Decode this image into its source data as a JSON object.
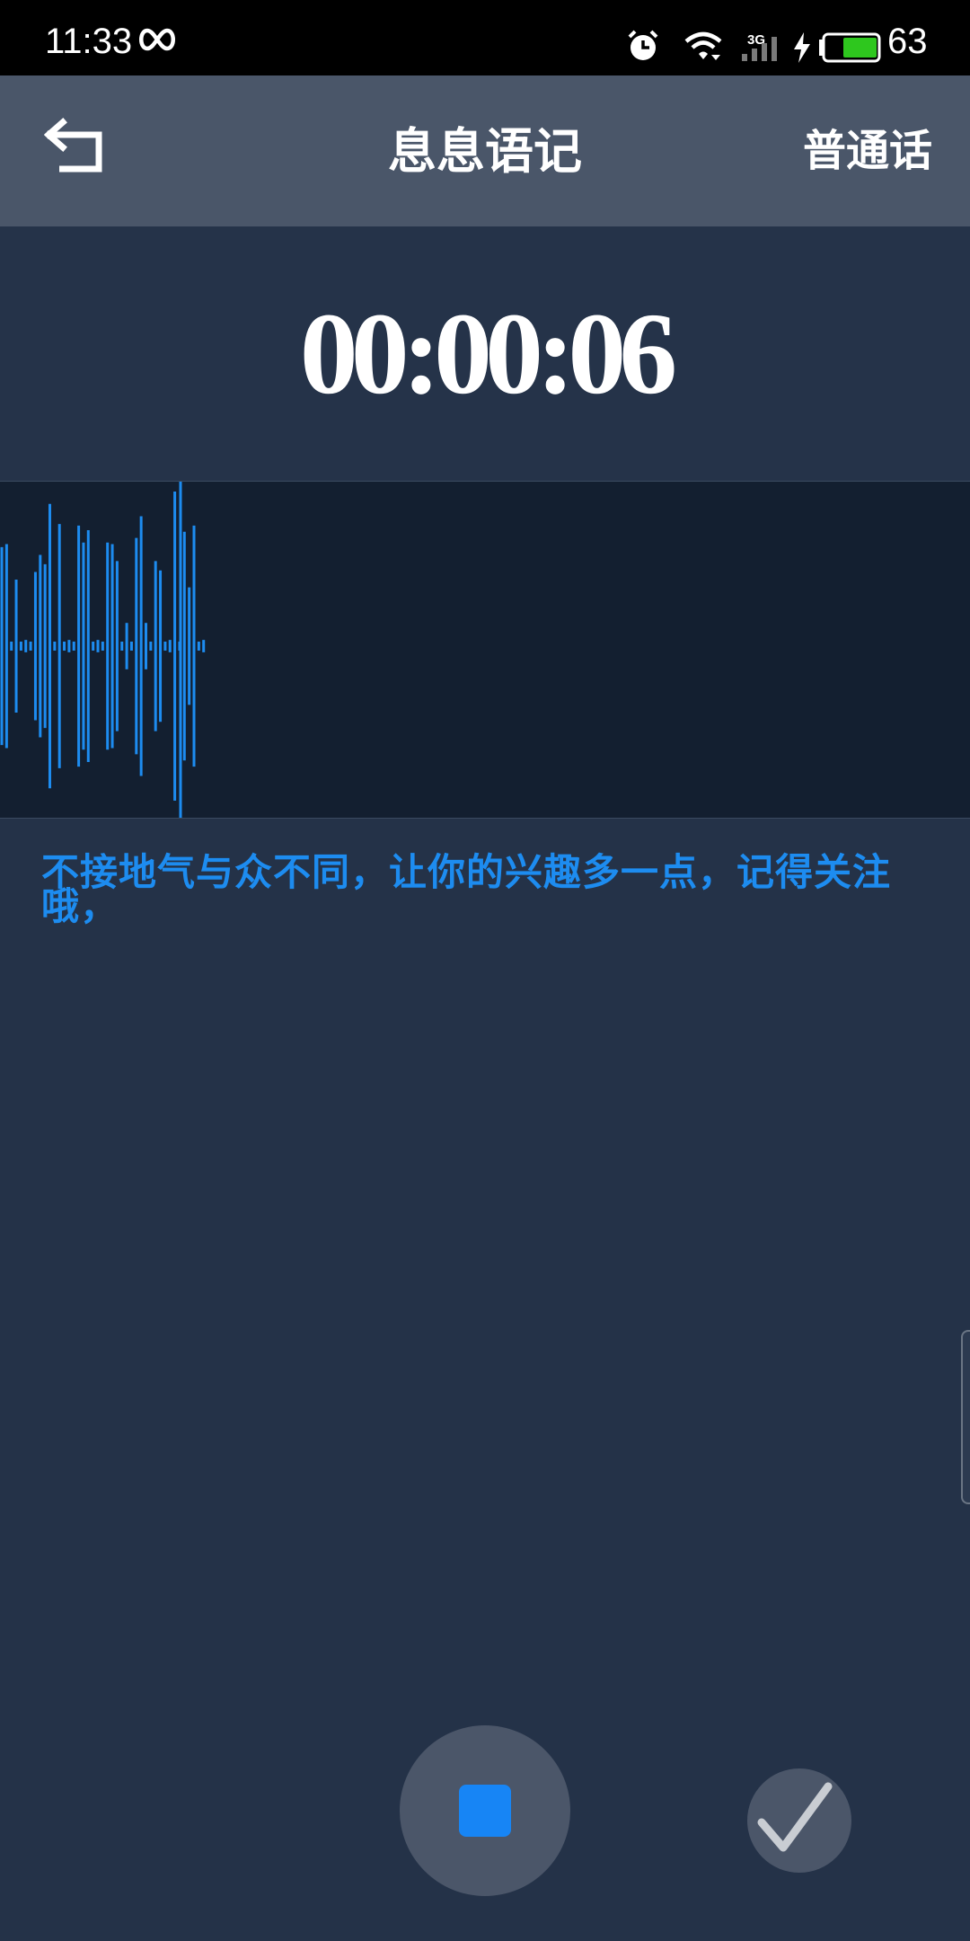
{
  "status_bar": {
    "time": "11:33",
    "network_type": "3G",
    "battery_percent": "63",
    "icons": [
      "infinity-icon",
      "alarm-icon",
      "wifi-icon",
      "signal-icon",
      "charging-icon",
      "battery-icon"
    ]
  },
  "header": {
    "back_icon": "back-arrow-icon",
    "title": "息息语记",
    "language": "普通话"
  },
  "recorder": {
    "elapsed_time": "00:00:06",
    "transcript": "不接地气与众不同，让你的兴趣多一点，记得关注哦，",
    "waveform": {
      "color": "#1d8cf0",
      "amplitudes": [
        0.64,
        0.66,
        0.0,
        0.43,
        0.0,
        0.04,
        0.0,
        0.48,
        0.59,
        0.53,
        0.92,
        0.0,
        0.79,
        0.0,
        0.04,
        0.0,
        0.78,
        0.67,
        0.75,
        0.0,
        0.04,
        0.0,
        0.67,
        0.66,
        0.55,
        0.0,
        0.15,
        0.0,
        0.7,
        0.84,
        0.15,
        0.0,
        0.55,
        0.49,
        0.0,
        0.04,
        1.0,
        0.0,
        0.74,
        0.38,
        0.78,
        0.0,
        0.04
      ]
    }
  },
  "controls": {
    "stop_icon": "stop-icon",
    "confirm_icon": "check-icon",
    "accent_color": "#1785f5"
  }
}
